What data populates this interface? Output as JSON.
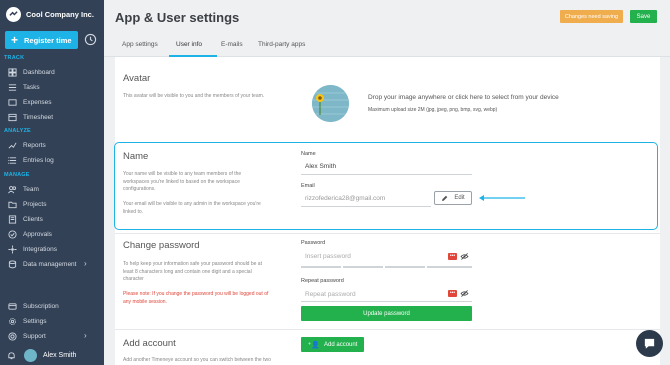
{
  "app": {
    "company": "Cool Company Inc.",
    "register_label": "Register time"
  },
  "sidebar": {
    "sections": {
      "track": "TRACK",
      "analyze": "ANALYZE",
      "manage": "MANAGE"
    },
    "track": [
      {
        "label": "Dashboard",
        "icon": "dashboard-icon"
      },
      {
        "label": "Tasks",
        "icon": "tasks-icon"
      },
      {
        "label": "Expenses",
        "icon": "expenses-icon"
      },
      {
        "label": "Timesheet",
        "icon": "timesheet-icon"
      }
    ],
    "analyze": [
      {
        "label": "Reports",
        "icon": "reports-icon"
      },
      {
        "label": "Entries log",
        "icon": "entries-log-icon"
      }
    ],
    "manage": [
      {
        "label": "Team",
        "icon": "team-icon"
      },
      {
        "label": "Projects",
        "icon": "projects-icon"
      },
      {
        "label": "Clients",
        "icon": "clients-icon"
      },
      {
        "label": "Approvals",
        "icon": "approvals-icon"
      },
      {
        "label": "Integrations",
        "icon": "integrations-icon"
      },
      {
        "label": "Data management",
        "icon": "data-management-icon"
      }
    ],
    "bottom": [
      {
        "label": "Subscription",
        "icon": "subscription-icon"
      },
      {
        "label": "Settings",
        "icon": "settings-icon"
      },
      {
        "label": "Support",
        "icon": "support-icon"
      }
    ],
    "user_name": "Alex Smith"
  },
  "header": {
    "title": "App & User settings",
    "changes_label": "Changes need saving",
    "save_label": "Save"
  },
  "tabs": [
    "App settings",
    "User info",
    "E-mails",
    "Third-party apps"
  ],
  "avatar": {
    "title": "Avatar",
    "desc": "This avatar will be visible to you and the members of your team.",
    "drop_text": "Drop your image anywhere or click here to select from your device",
    "drop_sub": "Maximum upload size 2M (jpg, jpeg, png, bmp, svg, webp)"
  },
  "name_section": {
    "title": "Name",
    "desc1": "Your name will be visible to any team members of the workspaces you're linked to based on the workspace configurations.",
    "desc2": "Your email will be visible to any admin in the workspace you're linked to.",
    "name_label": "Name",
    "name_value": "Alex Smith",
    "email_label": "Email",
    "email_value": "rizzofederica28@gmail.com",
    "edit_label": "Edit"
  },
  "password_section": {
    "title": "Change password",
    "desc": "To help keep your information safe your password should be at least 8 characters long and contain one digit and a special character",
    "warning": "Please note: If you change the password you will be logged out of any mobile session.",
    "password_label": "Password",
    "password_placeholder": "Insert password",
    "repeat_label": "Repeat password",
    "repeat_placeholder": "Repeat password",
    "dots": "•••",
    "update_label": "Update password"
  },
  "add_account": {
    "title": "Add account",
    "desc": "Add another Timeneye account so you can switch between the two",
    "button_label": "Add account"
  },
  "colors": {
    "accent": "#1db3e6",
    "sidebar": "#324156",
    "green": "#22b14c",
    "orange": "#f0ad4e",
    "danger": "#e0463a"
  }
}
